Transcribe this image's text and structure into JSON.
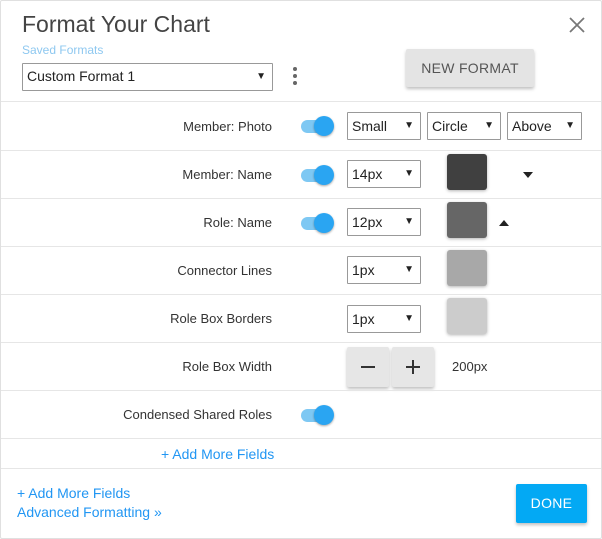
{
  "dialog": {
    "title": "Format Your Chart",
    "saved_formats_label": "Saved Formats",
    "format_select_value": "Custom Format 1",
    "new_format_label": "NEW FORMAT"
  },
  "rows": {
    "member_photo": {
      "label": "Member: Photo",
      "toggle_on": true,
      "size_value": "Small",
      "shape_value": "Circle",
      "position_value": "Above"
    },
    "member_name": {
      "label": "Member: Name",
      "toggle_on": true,
      "font_size_value": "14px",
      "color": "#404040"
    },
    "role_name": {
      "label": "Role: Name",
      "toggle_on": true,
      "font_size_value": "12px",
      "color": "#666666"
    },
    "connector_lines": {
      "label": "Connector Lines",
      "width_value": "1px",
      "color": "#a8a8a8"
    },
    "role_box_borders": {
      "label": "Role Box Borders",
      "width_value": "1px",
      "color": "#cccccc"
    },
    "role_box_width": {
      "label": "Role Box Width",
      "value": "200px"
    },
    "condensed_shared_roles": {
      "label": "Condensed Shared Roles",
      "toggle_on": true
    }
  },
  "add_more_fields_inline": "+ Add More Fields",
  "footer": {
    "add_more_fields": "+ Add More Fields",
    "advanced_formatting": "Advanced Formatting »",
    "done_label": "DONE"
  },
  "colors": {
    "accent": "#03a9f4",
    "toggle_knob": "#2aa5f2",
    "toggle_track": "#7ec8f3",
    "link": "#2196f3"
  },
  "icons": [
    "close-icon",
    "kebab-menu-icon",
    "dropdown-arrow-icon",
    "chevron-down-icon",
    "chevron-up-icon",
    "minus-icon",
    "plus-icon"
  ]
}
